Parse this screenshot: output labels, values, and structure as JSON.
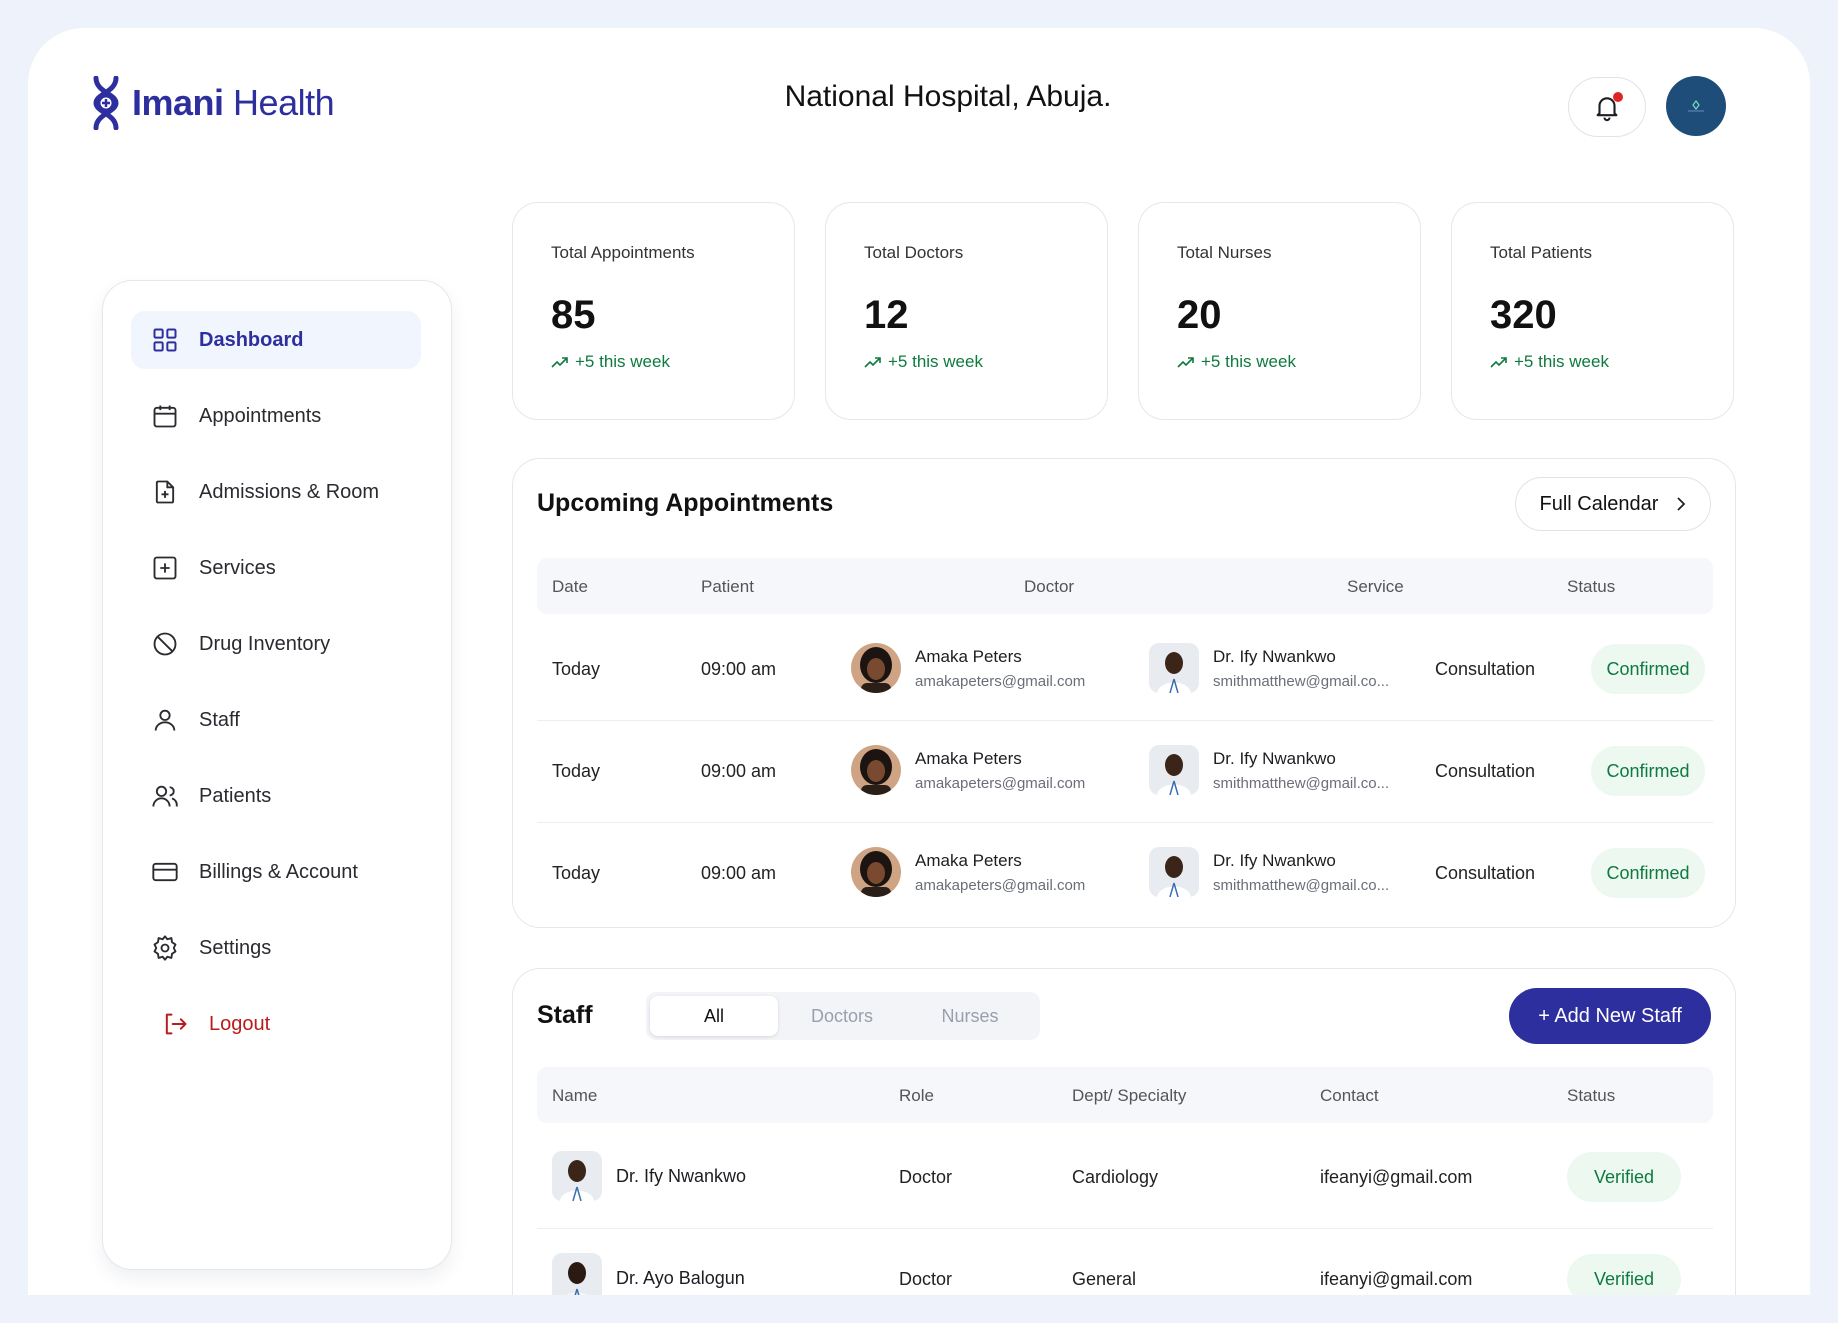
{
  "brand": {
    "name_bold": "Imani",
    "name_light": "Health"
  },
  "header": {
    "hospital": "National Hospital, Abuja."
  },
  "sidebar": {
    "items": [
      {
        "label": "Dashboard",
        "icon": "grid-icon"
      },
      {
        "label": "Appointments",
        "icon": "calendar-icon"
      },
      {
        "label": "Admissions & Room",
        "icon": "file-plus-icon"
      },
      {
        "label": "Services",
        "icon": "plus-square-icon"
      },
      {
        "label": "Drug Inventory",
        "icon": "ban-icon"
      },
      {
        "label": "Staff",
        "icon": "user-icon"
      },
      {
        "label": "Patients",
        "icon": "users-icon"
      },
      {
        "label": "Billings & Account",
        "icon": "credit-card-icon"
      },
      {
        "label": "Settings",
        "icon": "gear-icon"
      }
    ],
    "logout": "Logout"
  },
  "stats": [
    {
      "label": "Total Appointments",
      "value": "85",
      "trend": "+5 this week"
    },
    {
      "label": "Total Doctors",
      "value": "12",
      "trend": "+5 this week"
    },
    {
      "label": "Total Nurses",
      "value": "20",
      "trend": "+5 this week"
    },
    {
      "label": "Total Patients",
      "value": "320",
      "trend": "+5 this week"
    }
  ],
  "appointments": {
    "title": "Upcoming Appointments",
    "calendar_btn": "Full Calendar",
    "headers": {
      "date": "Date",
      "patient": "Patient",
      "doctor": "Doctor",
      "service": "Service",
      "status": "Status"
    },
    "rows": [
      {
        "date": "Today",
        "time": "09:00 am",
        "patient_name": "Amaka Peters",
        "patient_email": "amakapeters@gmail.com",
        "doctor_name": "Dr. Ify Nwankwo",
        "doctor_email": "smithmatthew@gmail.co...",
        "service": "Consultation",
        "status": "Confirmed"
      },
      {
        "date": "Today",
        "time": "09:00 am",
        "patient_name": "Amaka Peters",
        "patient_email": "amakapeters@gmail.com",
        "doctor_name": "Dr. Ify Nwankwo",
        "doctor_email": "smithmatthew@gmail.co...",
        "service": "Consultation",
        "status": "Confirmed"
      },
      {
        "date": "Today",
        "time": "09:00 am",
        "patient_name": "Amaka Peters",
        "patient_email": "amakapeters@gmail.com",
        "doctor_name": "Dr. Ify Nwankwo",
        "doctor_email": "smithmatthew@gmail.co...",
        "service": "Consultation",
        "status": "Confirmed"
      }
    ]
  },
  "staff": {
    "title": "Staff",
    "tabs": [
      "All",
      "Doctors",
      "Nurses"
    ],
    "add_btn": "+ Add New Staff",
    "headers": {
      "name": "Name",
      "role": "Role",
      "dept": "Dept/ Specialty",
      "contact": "Contact",
      "status": "Status"
    },
    "rows": [
      {
        "name": "Dr. Ify Nwankwo",
        "role": "Doctor",
        "dept": "Cardiology",
        "contact": "ifeanyi@gmail.com",
        "status": "Verified"
      },
      {
        "name": "Dr. Ayo Balogun",
        "role": "Doctor",
        "dept": "General",
        "contact": "ifeanyi@gmail.com",
        "status": "Verified"
      }
    ]
  }
}
